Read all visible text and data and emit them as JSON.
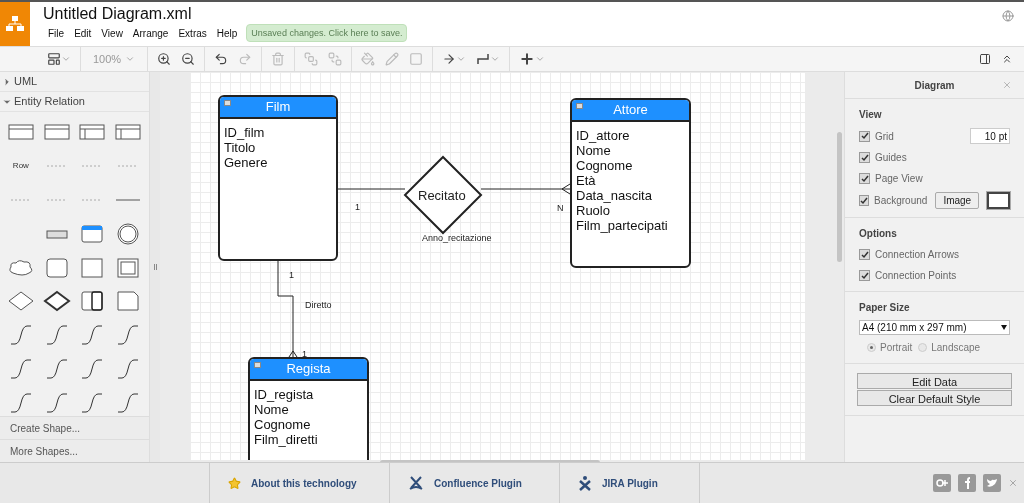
{
  "header": {
    "title": "Untitled Diagram.xml",
    "menu": [
      "File",
      "Edit",
      "View",
      "Arrange",
      "Extras",
      "Help"
    ],
    "save_notice": "Unsaved changes. Click here to save."
  },
  "toolbar": {
    "zoom": "100%"
  },
  "sidebar": {
    "sections": [
      {
        "label": "UML",
        "expanded": false
      },
      {
        "label": "Entity Relation",
        "expanded": true
      }
    ],
    "row_label": "Row",
    "links": [
      "Create Shape...",
      "More Shapes..."
    ]
  },
  "diagram": {
    "entities": [
      {
        "name": "Film",
        "attributes": [
          "ID_film",
          "Titolo",
          "Genere"
        ]
      },
      {
        "name": "Attore",
        "attributes": [
          "ID_attore",
          "Nome",
          "Cognome",
          "Età",
          "Data_nascita",
          "Ruolo",
          "Film_partecipati"
        ]
      },
      {
        "name": "Regista",
        "attributes": [
          "ID_regista",
          "Nome",
          "Cognome",
          "Film_diretti"
        ]
      }
    ],
    "relationship": {
      "name": "Recitato",
      "attribute": "Anno_recitazione"
    },
    "edge_labels": [
      {
        "kind": "film-card",
        "text": "1"
      },
      {
        "kind": "attore-card",
        "text": "N"
      },
      {
        "kind": "film-bottom",
        "text": "1"
      },
      {
        "kind": "diretto",
        "text": "Diretto"
      },
      {
        "kind": "regista-card",
        "text": "1"
      }
    ]
  },
  "format_panel": {
    "title": "Diagram",
    "view": {
      "heading": "View",
      "grid": {
        "label": "Grid",
        "checked": true,
        "value": "10 pt"
      },
      "guides": {
        "label": "Guides",
        "checked": true
      },
      "page_view": {
        "label": "Page View",
        "checked": true
      },
      "background": {
        "label": "Background",
        "checked": true,
        "button": "Image"
      }
    },
    "options": {
      "heading": "Options",
      "items": [
        {
          "label": "Connection Arrows",
          "checked": true
        },
        {
          "label": "Connection Points",
          "checked": true
        }
      ]
    },
    "paper": {
      "heading": "Paper Size",
      "value": "A4 (210 mm x 297 mm)",
      "orientations": [
        {
          "label": "Portrait",
          "selected": true
        },
        {
          "label": "Landscape",
          "selected": false
        }
      ]
    },
    "buttons": [
      "Edit Data",
      "Clear Default Style"
    ]
  },
  "footer": {
    "links": [
      {
        "kind": "star",
        "label": "About this technology"
      },
      {
        "kind": "confluence",
        "label": "Confluence Plugin"
      },
      {
        "kind": "jira",
        "label": "JIRA Plugin"
      }
    ]
  }
}
